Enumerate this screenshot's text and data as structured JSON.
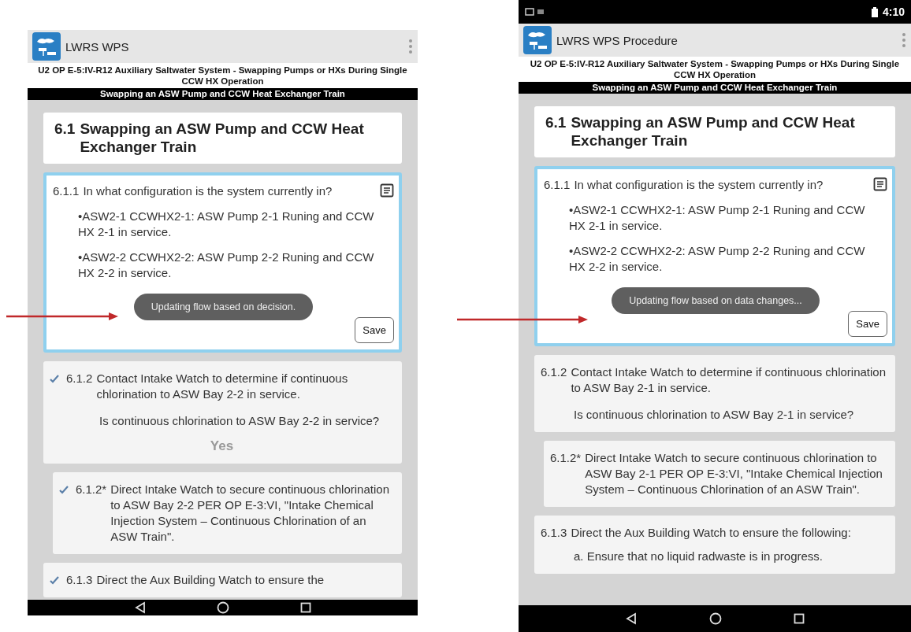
{
  "phones": [
    {
      "app_title": "LWRS WPS",
      "doc_title": "U2 OP E-5:IV-R12 Auxiliary Saltwater System - Swapping Pumps or HXs During Single CCW HX Operation",
      "banner": "Swapping an ASW Pump and CCW Heat Exchanger Train",
      "section": {
        "number": "6.1",
        "title": "Swapping an ASW Pump and CCW Heat Exchanger Train"
      },
      "steps": [
        {
          "kind": "question",
          "number": "6.1.1",
          "text": "In what configuration is the system currently in?",
          "bullets": [
            "•ASW2-1 CCWHX2-1: ASW Pump 2-1 Runing and CCW HX 2-1 in service.",
            "•ASW2-2 CCWHX2-2: ASW Pump 2-2 Runing and CCW HX 2-2 in service."
          ],
          "toast": "Updating flow based on decision.",
          "save": "Save"
        },
        {
          "kind": "decision",
          "number": "6.1.2",
          "text": "Contact Intake Watch to determine if continuous chlorination to ASW Bay 2-2 in service.",
          "question": "Is continuous chlorination to ASW Bay 2-2 in service?",
          "answer": "Yes",
          "checked": true
        },
        {
          "kind": "substep",
          "number": "6.1.2*",
          "text": "Direct Intake Watch to secure continuous chlorination to ASW Bay 2-2 PER OP E-3:VI, \"Intake Chemical Injection System – Continuous Chlorination of an ASW Train\".",
          "checked": true
        },
        {
          "kind": "step",
          "number": "6.1.3",
          "text": "Direct the Aux Building Watch to ensure the",
          "checked": true
        }
      ]
    },
    {
      "status_bar": {
        "time": "4:10"
      },
      "app_title": "LWRS WPS Procedure",
      "doc_title": "U2 OP E-5:IV-R12 Auxiliary Saltwater System - Swapping Pumps or HXs During Single CCW HX Operation",
      "banner": "Swapping an ASW Pump and CCW Heat Exchanger Train",
      "section": {
        "number": "6.1",
        "title": "Swapping an ASW Pump and CCW Heat Exchanger Train"
      },
      "steps": [
        {
          "kind": "question",
          "number": "6.1.1",
          "text": "In what configuration is the system currently in?",
          "bullets": [
            "•ASW2-1 CCWHX2-1: ASW Pump 2-1 Runing and CCW HX 2-1 in service.",
            "•ASW2-2 CCWHX2-2: ASW Pump 2-2 Runing and CCW HX 2-2 in service."
          ],
          "toast": "Updating flow based on data changes...",
          "save": "Save"
        },
        {
          "kind": "decision",
          "number": "6.1.2",
          "text": "Contact Intake Watch to determine if continuous chlorination to ASW Bay 2-1 in service.",
          "question": "Is continuous chlorination to ASW Bay 2-1 in service?",
          "checked": false
        },
        {
          "kind": "substep",
          "number": "6.1.2*",
          "text": "Direct Intake Watch to secure continuous chlorination to ASW Bay 2-1 PER OP E-3:VI, \"Intake Chemical Injection System – Continuous Chlorination of an ASW Train\".",
          "checked": false
        },
        {
          "kind": "step",
          "number": "6.1.3",
          "text": "Direct the Aux Building Watch to ensure the following:",
          "items": [
            "a. Ensure that no liquid radwaste is in progress."
          ],
          "checked": false
        }
      ]
    }
  ]
}
